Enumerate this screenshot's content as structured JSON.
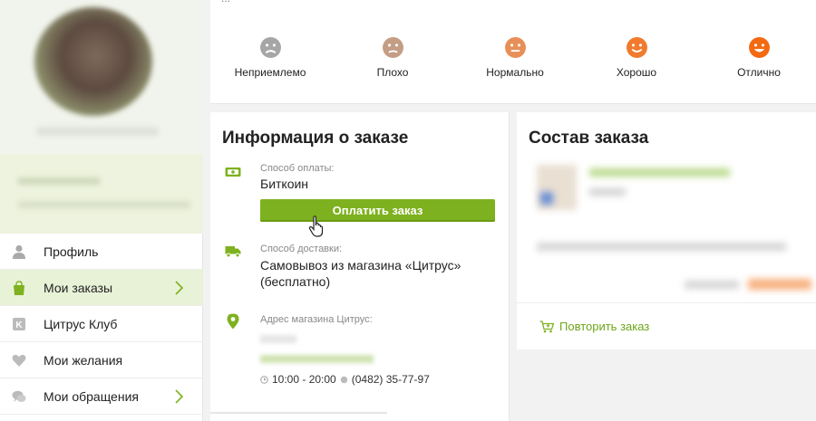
{
  "rating": {
    "prompt": "...",
    "options": [
      {
        "label": "Неприемлемо",
        "icon": "very-sad-face-icon",
        "color": "#a6a6a6"
      },
      {
        "label": "Плохо",
        "icon": "sad-face-icon",
        "color": "#c49d85"
      },
      {
        "label": "Нормально",
        "icon": "neutral-face-icon",
        "color": "#e88f58"
      },
      {
        "label": "Хорошо",
        "icon": "smile-face-icon",
        "color": "#f07a2d"
      },
      {
        "label": "Отлично",
        "icon": "happy-face-icon",
        "color": "#f36a12"
      }
    ]
  },
  "sidebar": {
    "menu": [
      {
        "label": "Профиль",
        "icon": "user-icon"
      },
      {
        "label": "Мои заказы",
        "icon": "shopping-bag-icon",
        "active": true
      },
      {
        "label": "Цитрус Клуб",
        "icon": "club-badge-icon"
      },
      {
        "label": "Мои желания",
        "icon": "heart-icon"
      },
      {
        "label": "Мои обращения",
        "icon": "chat-icon"
      }
    ]
  },
  "order_info": {
    "title": "Информация о заказе",
    "payment_label": "Способ оплаты:",
    "payment_value": "Биткоин",
    "pay_button": "Оплатить заказ",
    "delivery_label": "Способ доставки:",
    "delivery_value": "Самовывоз из магазина «Цитрус» (бесплатно)",
    "store_label": "Адрес магазина Цитрус:",
    "hours": "10:00 - 20:00",
    "phone": "(0482) 35-77-97"
  },
  "order_contents": {
    "title": "Состав заказа",
    "repeat_label": "Повторить заказ"
  },
  "colors": {
    "accent_green": "#7eb11f",
    "link_green": "#6ea51b",
    "active_menu_bg": "#e8f2d7"
  }
}
